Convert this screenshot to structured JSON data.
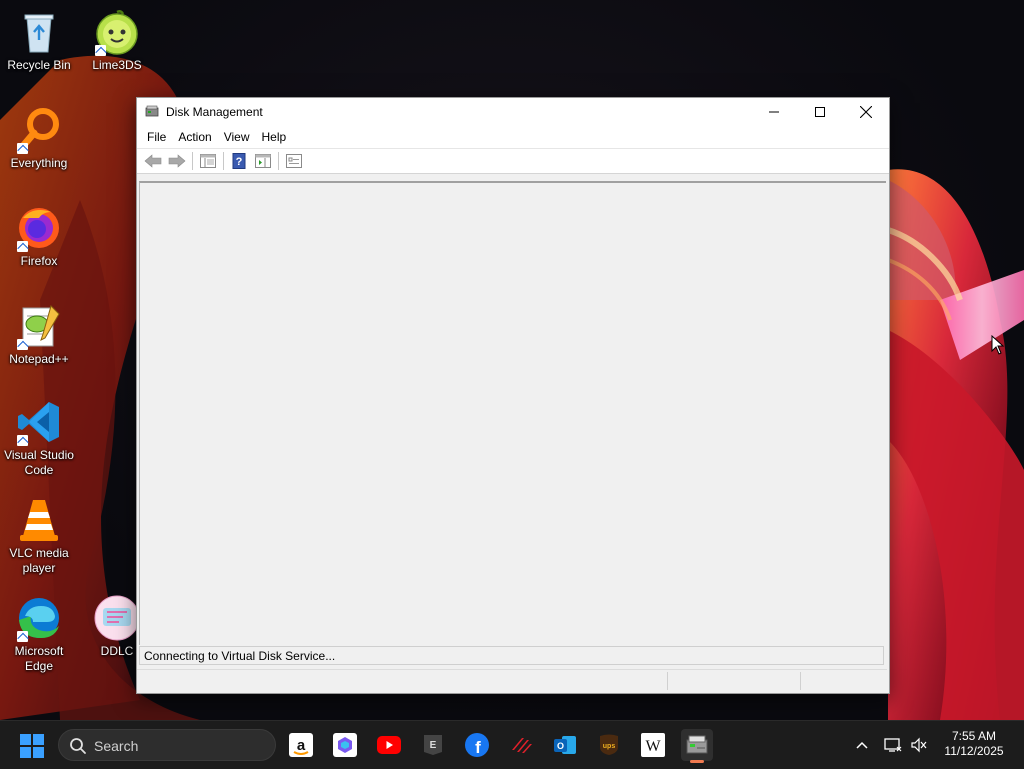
{
  "desktop": {
    "icons": [
      {
        "label": "Recycle Bin",
        "icon": "recycle-bin-icon"
      },
      {
        "label": "Lime3DS",
        "icon": "lime3ds-icon"
      },
      {
        "label": "Everything",
        "icon": "everything-search-icon"
      },
      {
        "label": "Firefox",
        "icon": "firefox-icon"
      },
      {
        "label": "Notepad++",
        "icon": "notepad-plus-plus-icon"
      },
      {
        "label": "Visual Studio Code",
        "label_line1": "Visual Studio",
        "label_line2": "Code",
        "icon": "vscode-icon"
      },
      {
        "label": "VLC media player",
        "label_line1": "VLC media",
        "label_line2": "player",
        "icon": "vlc-icon"
      },
      {
        "label": "Microsoft Edge",
        "label_line1": "Microsoft",
        "label_line2": "Edge",
        "icon": "edge-icon"
      },
      {
        "label": "DDLC",
        "icon": "ddlc-icon"
      }
    ]
  },
  "window": {
    "title": "Disk Management",
    "menu": [
      "File",
      "Action",
      "View",
      "Help"
    ],
    "toolbar": [
      "back-arrow-icon",
      "forward-arrow-icon",
      "show-hide-console-tree-icon",
      "help-icon",
      "show-hide-action-pane-icon",
      "properties-icon"
    ],
    "status_text": "Connecting to Virtual Disk Service..."
  },
  "taskbar": {
    "search_placeholder": "Search",
    "apps": [
      "amazon-icon",
      "copilot-icon",
      "youtube-icon",
      "epic-games-icon",
      "facebook-icon",
      "bank-app-icon",
      "outlook-icon",
      "ups-icon",
      "wikipedia-icon",
      "disk-management-icon"
    ],
    "active_app": "disk-management-icon",
    "clock_time": "7:55 AM",
    "clock_date": "11/12/2025"
  },
  "colors": {
    "taskbar_bg": "#1c1c1c",
    "window_bg": "#f0f0f0",
    "active_indicator": "#f07a50"
  }
}
